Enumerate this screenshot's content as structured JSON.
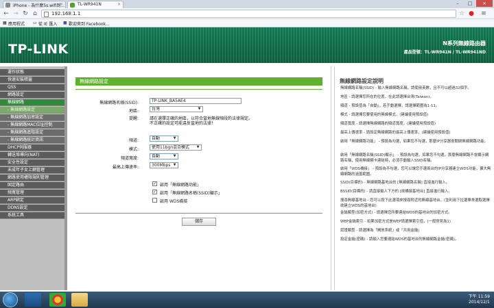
{
  "browser": {
    "tabs": [
      {
        "label": "iPhone - 為什麼5s.wifi到..."
      },
      {
        "label": "TL-WR941N"
      }
    ],
    "url": "192.168.1.1",
    "bookmarks": [
      {
        "label": "應用程式"
      },
      {
        "label": "從 IE 匯入"
      },
      {
        "label": "歡迎來到 Facebook..."
      }
    ]
  },
  "router": {
    "brand": "TP-LINK",
    "product_line": "N系列無線路由器",
    "model": "產品型號：TL-WR941N / TL-WR941ND"
  },
  "sidebar": {
    "items": [
      {
        "label": "運作狀態"
      },
      {
        "label": "快速安裝精靈"
      },
      {
        "label": "QSS"
      },
      {
        "label": "網路設定"
      },
      {
        "label": "無線網路"
      },
      {
        "label": "- 無線網路設定"
      },
      {
        "label": "- 無線網路加密設定"
      },
      {
        "label": "- 無線網路MAC位址控制"
      },
      {
        "label": "- 無線網路進階設定"
      },
      {
        "label": "- 無線網路統計資訊"
      },
      {
        "label": "DHCP伺服器"
      },
      {
        "label": "轉送埠導向(NAT)"
      },
      {
        "label": "安全性設定"
      },
      {
        "label": "未成年子女上網管理"
      },
      {
        "label": "網路使用權限規則管理"
      },
      {
        "label": "固定路由"
      },
      {
        "label": "頻寬管理"
      },
      {
        "label": "ARP綁定"
      },
      {
        "label": "DDNS設定"
      },
      {
        "label": "系統工具"
      }
    ]
  },
  "form": {
    "title": "無線網路設定",
    "ssid_label": "無線網路名稱(SSID):",
    "ssid_value": "TP-LINK_BA5AE4",
    "region_label": "地區:",
    "region_value": "台灣",
    "warning_label": "提醒:",
    "warning_text_1": "請在選擇正確的地區，以符合當地無線頻段的法律規定。",
    "warning_text_2": "不正確的設定可能違反當地的法律！",
    "channel_label": "頻道:",
    "channel_value": "自動",
    "mode_label": "模式:",
    "mode_value": "使用11bgn混合模式",
    "bandwidth_label": "頻道寬度:",
    "bandwidth_value": "自動",
    "maxrate_label": "最高上傳速率:",
    "maxrate_value": "300Mbps",
    "cb_radio_label": "啟用「無線網路功能」",
    "cb_ssid_label": "啟用「無線網路名稱(SSID)顯示」",
    "cb_wds_label": "啟用 WDS橋接",
    "check_mark": "✓",
    "save_label": "儲存"
  },
  "help": {
    "title": "無線網路設定說明",
    "paragraphs": [
      "無線網路名稱(SSID) - 輸入無線網路名稱，請使用英數，且不可以超過32個字。",
      "地區 - 請選擇您所在的位置，在此請選擇台灣(Taiwan)。",
      "頻道 - 預設值為「自動」，若手動選擇，請選擇範圍為1-11。",
      "模式 - 請選擇您要使用的無線模式，(建議使用預設值)",
      "頻道寬度 - 請選擇無線網路的頻道寬度，(建議使用預設值)",
      "最高上傳速率 - 請設定無線網路的最高上傳速率，(建議使用預設值)",
      "啟用「無線網路功能」 - 預設為勾選，如果您不勾選，那麼IP分享器會關閉無線網路功能。",
      "啟用「無線網路名稱(SSID)顯示」 - 預設為勾選，如果您不勾選，那麼無線網路不會顯示網路名稱，使用無線網卡連結時，必須手動輸入SSID名稱。",
      "啟用「WDS橋接」 - 預設為不勾選，您可以讓您手邊兩台的IP分享器建立WDS功能，擴大無線網路的涵蓋範圍。",
      "SSID(目標的) - 無線網路基地台的 [無線網路名稱] 直接進行輸入。",
      "BSSID(目標的) - 請直接輸入下方的 [欲橋接基地台] 直接進行輸入。",
      "搜尋無線基地台 - 您可以按下此選項來搜尋附近的無線基地台，(並利用下拉選單來選取選擇欲建立WDS的基地台)",
      "金鑰類型(加密方式) - 請選擇您所要連結WDS的基地台的加密方式。",
      "WEP金鑰索引 - 如果加密方式是WEP請選擇索引值，(一般常見為1)",
      "認證類型 - 請選擇為「開放系統」或「共用金鑰」",
      "設定金鑰(密碼) - 請輸入您要連結WDS的基地台的無線網路金鑰(密碼)。"
    ]
  },
  "taskbar": {
    "time": "下午 11:59",
    "date": "2014/12/1"
  },
  "colors": {
    "brand_green": "#0a5e3e",
    "accent_green": "#62b030",
    "sidebar_bg": "#5c5c5c"
  }
}
